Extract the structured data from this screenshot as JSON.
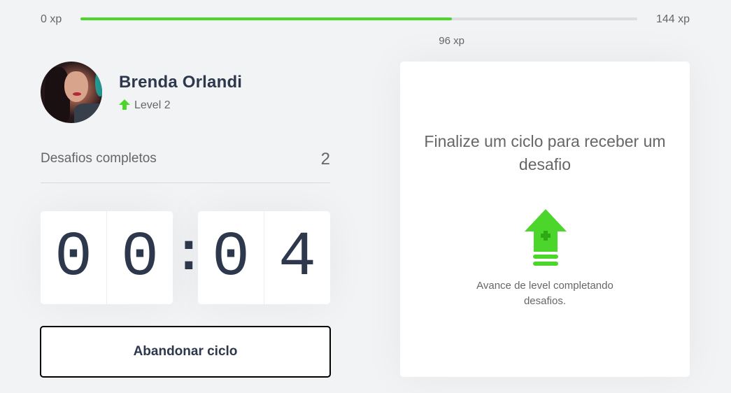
{
  "xp": {
    "min_label": "0 xp",
    "max_label": "144 xp",
    "current_label": "96 xp",
    "current": 96,
    "max": 144,
    "color": "#4cd62b"
  },
  "profile": {
    "name": "Brenda Orlandi",
    "level_label": "Level 2",
    "level_icon": "level-up-arrow-icon"
  },
  "completed": {
    "label": "Desafios completos",
    "value": "2"
  },
  "countdown": {
    "minute_left": "0",
    "minute_right": "0",
    "separator": ":",
    "second_left": "0",
    "second_right": "4"
  },
  "actions": {
    "abandon_label": "Abandonar ciclo"
  },
  "challenge": {
    "title": "Finalize um ciclo para receber um desafio",
    "icon": "level-up-icon",
    "text": "Avance de level completando desafios."
  },
  "colors": {
    "accent_green": "#4cd62b",
    "background": "#f2f3f5",
    "text_dark": "#2e384d",
    "text_muted": "#666666"
  }
}
